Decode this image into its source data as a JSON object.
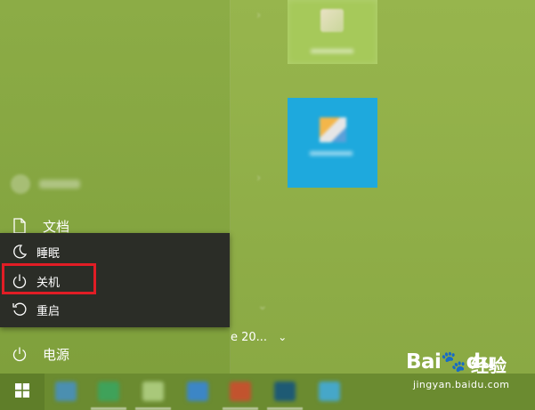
{
  "menu_items": {
    "documents": "文档",
    "power": "电源"
  },
  "power_menu": {
    "items": [
      {
        "label": "睡眠",
        "icon": "moon-icon"
      },
      {
        "label": "关机",
        "icon": "power-icon"
      },
      {
        "label": "重启",
        "icon": "restart-icon"
      }
    ],
    "highlighted": "关机"
  },
  "tiles_panel": {
    "truncated_date": "e 20..."
  },
  "watermark": {
    "logo": "Bai🐾du",
    "cn_text": "经验",
    "url": "jingyan.baidu.com"
  },
  "colors": {
    "accent_green": "#8cac46",
    "menu_bg": "#2b2d27",
    "highlight_red": "#e11d25",
    "tile_blue": "#1ea9dd",
    "tile_green": "#a6c95a"
  }
}
